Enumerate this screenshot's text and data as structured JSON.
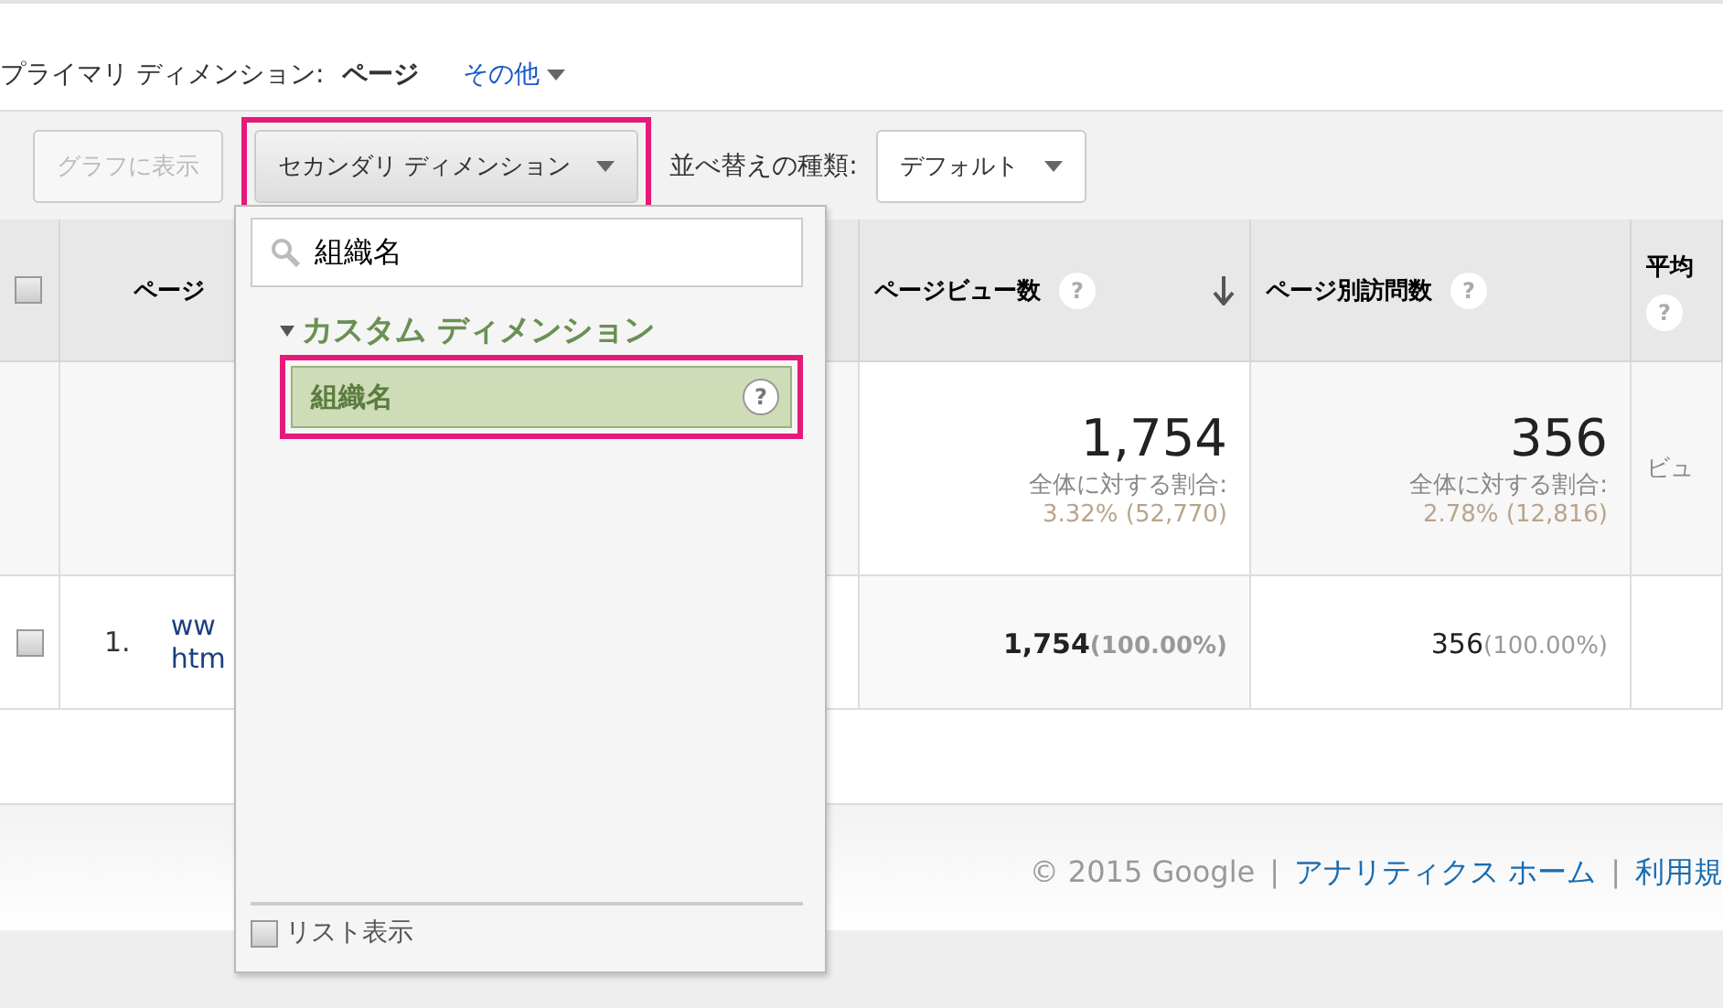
{
  "primary_dimension": {
    "label": "プライマリ ディメンション:",
    "value": "ページ",
    "other": "その他"
  },
  "toolbar": {
    "chart_button": {
      "label": "グラフに表示",
      "disabled": true
    },
    "secondary_button": {
      "label": "セカンダリ ディメンション",
      "highlighted": true
    },
    "sort_label": "並べ替えの種類:",
    "sort_select": "デフォルト"
  },
  "table": {
    "select_all": {
      "checked": false
    },
    "columns": [
      {
        "label": "ページ",
        "sorted": false
      },
      {
        "label": "ページビュー数",
        "help": "?",
        "sorted": true
      },
      {
        "label": "ページ別訪問数",
        "help": "?",
        "sorted": false
      },
      {
        "label": "平均",
        "help": "?",
        "sorted": false
      }
    ],
    "summary": [
      {
        "value": "1,754",
        "caption": "全体に対する割合:",
        "detail": "3.32% (52,770)"
      },
      {
        "value": "356",
        "caption": "全体に対する割合:",
        "detail": "2.78% (12,816)"
      },
      {
        "caption": "ビュ"
      }
    ],
    "rows": [
      {
        "checked": false,
        "index": "1.",
        "page": [
          "ww",
          "htm"
        ],
        "pageviews": "1,754",
        "pageviews_share": "(100.00%)",
        "visits": "356",
        "visits_share": "(100.00%)"
      }
    ]
  },
  "footer": [
    {
      "kind": "text",
      "text": "© 2015 Google"
    },
    {
      "kind": "separator",
      "text": "|"
    },
    {
      "kind": "link",
      "text": "アナリティクス ホーム"
    },
    {
      "kind": "separator",
      "text": "|"
    },
    {
      "kind": "link",
      "text": "利用規"
    }
  ],
  "dropdown": {
    "search": "組織名",
    "groups": [
      {
        "label": "カスタム ディメンション",
        "expanded": true,
        "items": [
          {
            "label": "組織名",
            "help": "?",
            "selected": true,
            "highlighted": true
          }
        ]
      }
    ],
    "list_view": {
      "label": "リスト表示",
      "checked": false
    }
  }
}
